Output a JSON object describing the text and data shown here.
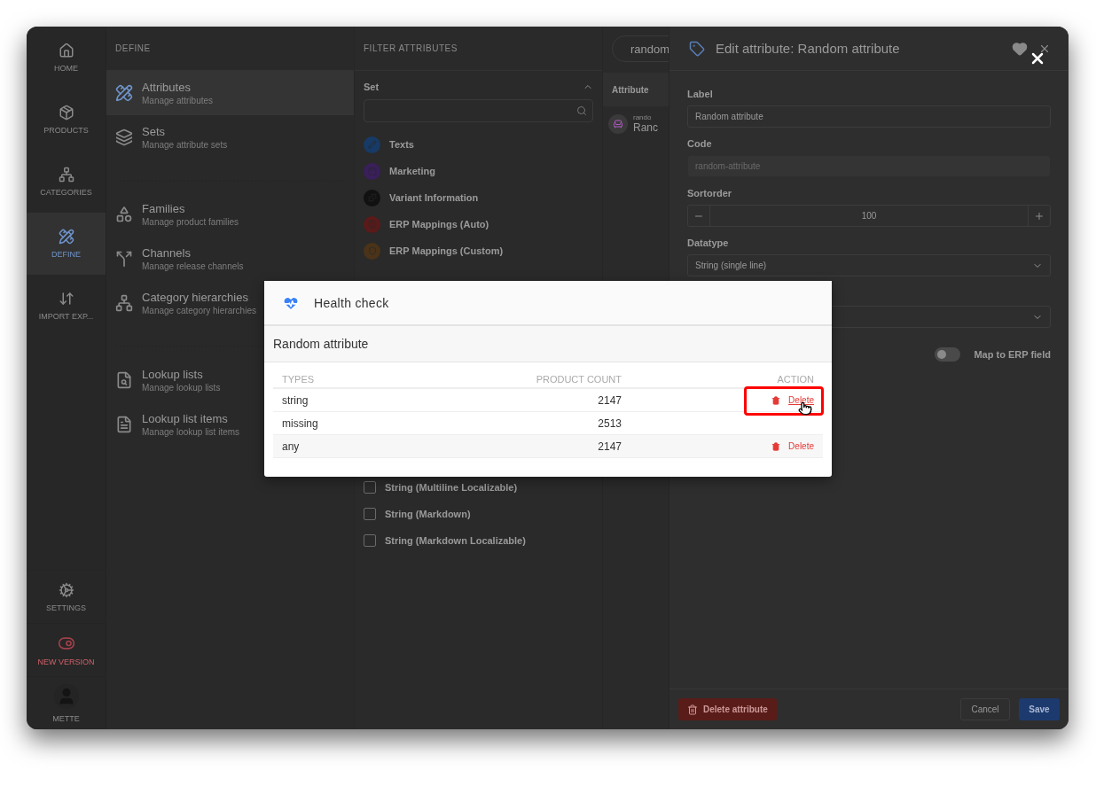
{
  "nav": {
    "items": [
      {
        "label": "HOME",
        "selected": false
      },
      {
        "label": "PRODUCTS",
        "selected": false
      },
      {
        "label": "CATEGORIES",
        "selected": false
      },
      {
        "label": "DEFINE",
        "selected": true
      },
      {
        "label": "IMPORT EXP...",
        "selected": false
      }
    ],
    "bottom_items": [
      {
        "label": "SETTINGS",
        "kind": "settings"
      },
      {
        "label": "NEW VERSION",
        "kind": "toggle"
      },
      {
        "label": "METTE",
        "kind": "avatar"
      }
    ]
  },
  "define_menu": {
    "title": "DEFINE",
    "groups": [
      [
        {
          "title": "Attributes",
          "subtitle": "Manage attributes",
          "selected": true
        },
        {
          "title": "Sets",
          "subtitle": "Manage attribute sets",
          "selected": false
        }
      ],
      [
        {
          "title": "Families",
          "subtitle": "Manage product families",
          "selected": false
        },
        {
          "title": "Channels",
          "subtitle": "Manage release channels",
          "selected": false
        },
        {
          "title": "Category hierarchies",
          "subtitle": "Manage category hierarchies",
          "selected": false
        }
      ],
      [
        {
          "title": "Lookup lists",
          "subtitle": "Manage lookup lists",
          "selected": false
        },
        {
          "title": "Lookup list items",
          "subtitle": "Manage lookup list items",
          "selected": false
        }
      ]
    ]
  },
  "filter": {
    "title": "FILTER ATTRIBUTES",
    "set_section": {
      "label": "Set",
      "expanded": true
    },
    "sets": [
      {
        "label": "Texts",
        "color": "#173a66"
      },
      {
        "label": "Marketing",
        "color": "#3a1f5c"
      },
      {
        "label": "Variant Information",
        "color": "#111111"
      },
      {
        "label": "ERP Mappings (Auto)",
        "color": "#5a1a1a"
      },
      {
        "label": "ERP Mappings (Custom)",
        "color": "#4a3318"
      }
    ],
    "datatypes": [
      {
        "label": "String (Multiline Localizable)",
        "checked": false
      },
      {
        "label": "String (Markdown)",
        "checked": false
      },
      {
        "label": "String (Markdown Localizable)",
        "checked": false
      }
    ]
  },
  "attribute_list": {
    "search": {
      "value": "random"
    },
    "column": "Attribute",
    "rows": [
      {
        "code": "rando",
        "name": "Ranc"
      }
    ]
  },
  "edit_panel": {
    "title": "Edit attribute: Random attribute",
    "fields": [
      {
        "kind": "text",
        "label": "Label",
        "value": "Random attribute",
        "disabled": false
      },
      {
        "kind": "text",
        "label": "Code",
        "value": "random-attribute",
        "disabled": true
      },
      {
        "kind": "stepper",
        "label": "Sortorder",
        "value": "100"
      },
      {
        "kind": "select",
        "label": "Datatype",
        "value": "String (single line)"
      },
      {
        "kind": "select"
      }
    ],
    "toggle": {
      "label": "Map to ERP field",
      "on": false
    },
    "delete_button": "Delete attribute",
    "cancel_button": "Cancel",
    "save_button": "Save"
  },
  "modal": {
    "title": "Health check",
    "subtitle": "Random attribute",
    "columns": [
      "TYPES",
      "PRODUCT COUNT",
      "ACTION"
    ],
    "rows": [
      {
        "type": "string",
        "count": "2147",
        "action": "Delete",
        "highlighted": true
      },
      {
        "type": "missing",
        "count": "2513"
      },
      {
        "type": "any",
        "count": "2147",
        "action": "Delete",
        "highlighted": false
      }
    ]
  }
}
